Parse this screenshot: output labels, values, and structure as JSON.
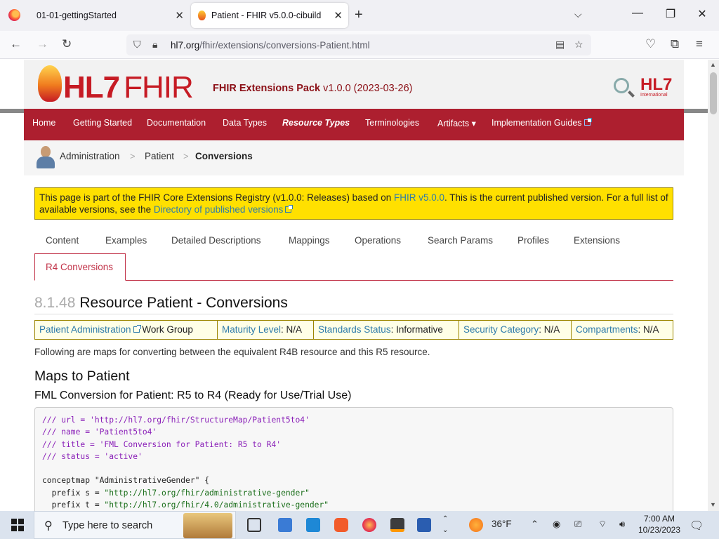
{
  "browser": {
    "tabs": [
      {
        "title": "01-01-gettingStarted",
        "active": false
      },
      {
        "title": "Patient - FHIR v5.0.0-cibuild",
        "active": true
      }
    ],
    "url_host": "hl7.org",
    "url_path": "/fhir/extensions/conversions-Patient.html"
  },
  "header": {
    "logo_hl7": "HL7",
    "logo_fhir": "FHIR",
    "site_name": "FHIR Extensions Pack",
    "site_version": "v1.0.0 (2023-03-26)",
    "hl7_badge": "HL7",
    "hl7_badge_sub": "International"
  },
  "menu": [
    {
      "label": "Home"
    },
    {
      "label": "Getting Started"
    },
    {
      "label": "Documentation"
    },
    {
      "label": "Data Types"
    },
    {
      "label": "Resource Types"
    },
    {
      "label": "Terminologies"
    },
    {
      "label": "Artifacts"
    },
    {
      "label": "Implementation Guides"
    }
  ],
  "breadcrumb": [
    "Administration",
    "Patient",
    "Conversions"
  ],
  "notice": {
    "text1": "This page is part of the FHIR Core Extensions Registry (v1.0.0: Releases) based on ",
    "link1": "FHIR v5.0.0",
    "text2": ". This is the current published version. For a full list of available versions, see the ",
    "link2": "Directory of published versions"
  },
  "page_tabs": [
    "Content",
    "Examples",
    "Detailed Descriptions",
    "Mappings",
    "Operations",
    "Search Params",
    "Profiles",
    "Extensions",
    "R4 Conversions"
  ],
  "heading": {
    "number": "8.1.48",
    "title": "Resource Patient - Conversions"
  },
  "meta": {
    "workgroup_link": "Patient Administration",
    "workgroup_suffix": " Work Group",
    "maturity_label": "Maturity Level",
    "maturity_value": ": N/A",
    "standards_label": "Standards Status",
    "standards_value": ": Informative",
    "security_label": "Security Category",
    "security_value": ": N/A",
    "compartments_label": "Compartments",
    "compartments_value": ": N/A"
  },
  "intro": "Following are maps for converting between the equivalent R4B resource and this R5 resource.",
  "maps_heading": "Maps to Patient",
  "fml_heading": "FML Conversion for Patient: R5 to R4 (Ready for Use/Trial Use)",
  "code": {
    "l1": "/// url = 'http://hl7.org/fhir/StructureMap/Patient5to4'",
    "l2": "/// name = 'Patient5to4'",
    "l3": "/// title = 'FML Conversion for Patient: R5 to R4'",
    "l4": "/// status = 'active'",
    "l6": "conceptmap \"AdministrativeGender\" {",
    "l7a": "  prefix s = ",
    "l7b": "\"http://hl7.org/fhir/administrative-gender\"",
    "l8a": "  prefix t = ",
    "l8b": "\"http://hl7.org/fhir/4.0/administrative-gender\""
  },
  "taskbar": {
    "search_placeholder": "Type here to search",
    "weather": "36°F",
    "time": "7:00 AM",
    "date": "10/23/2023"
  }
}
